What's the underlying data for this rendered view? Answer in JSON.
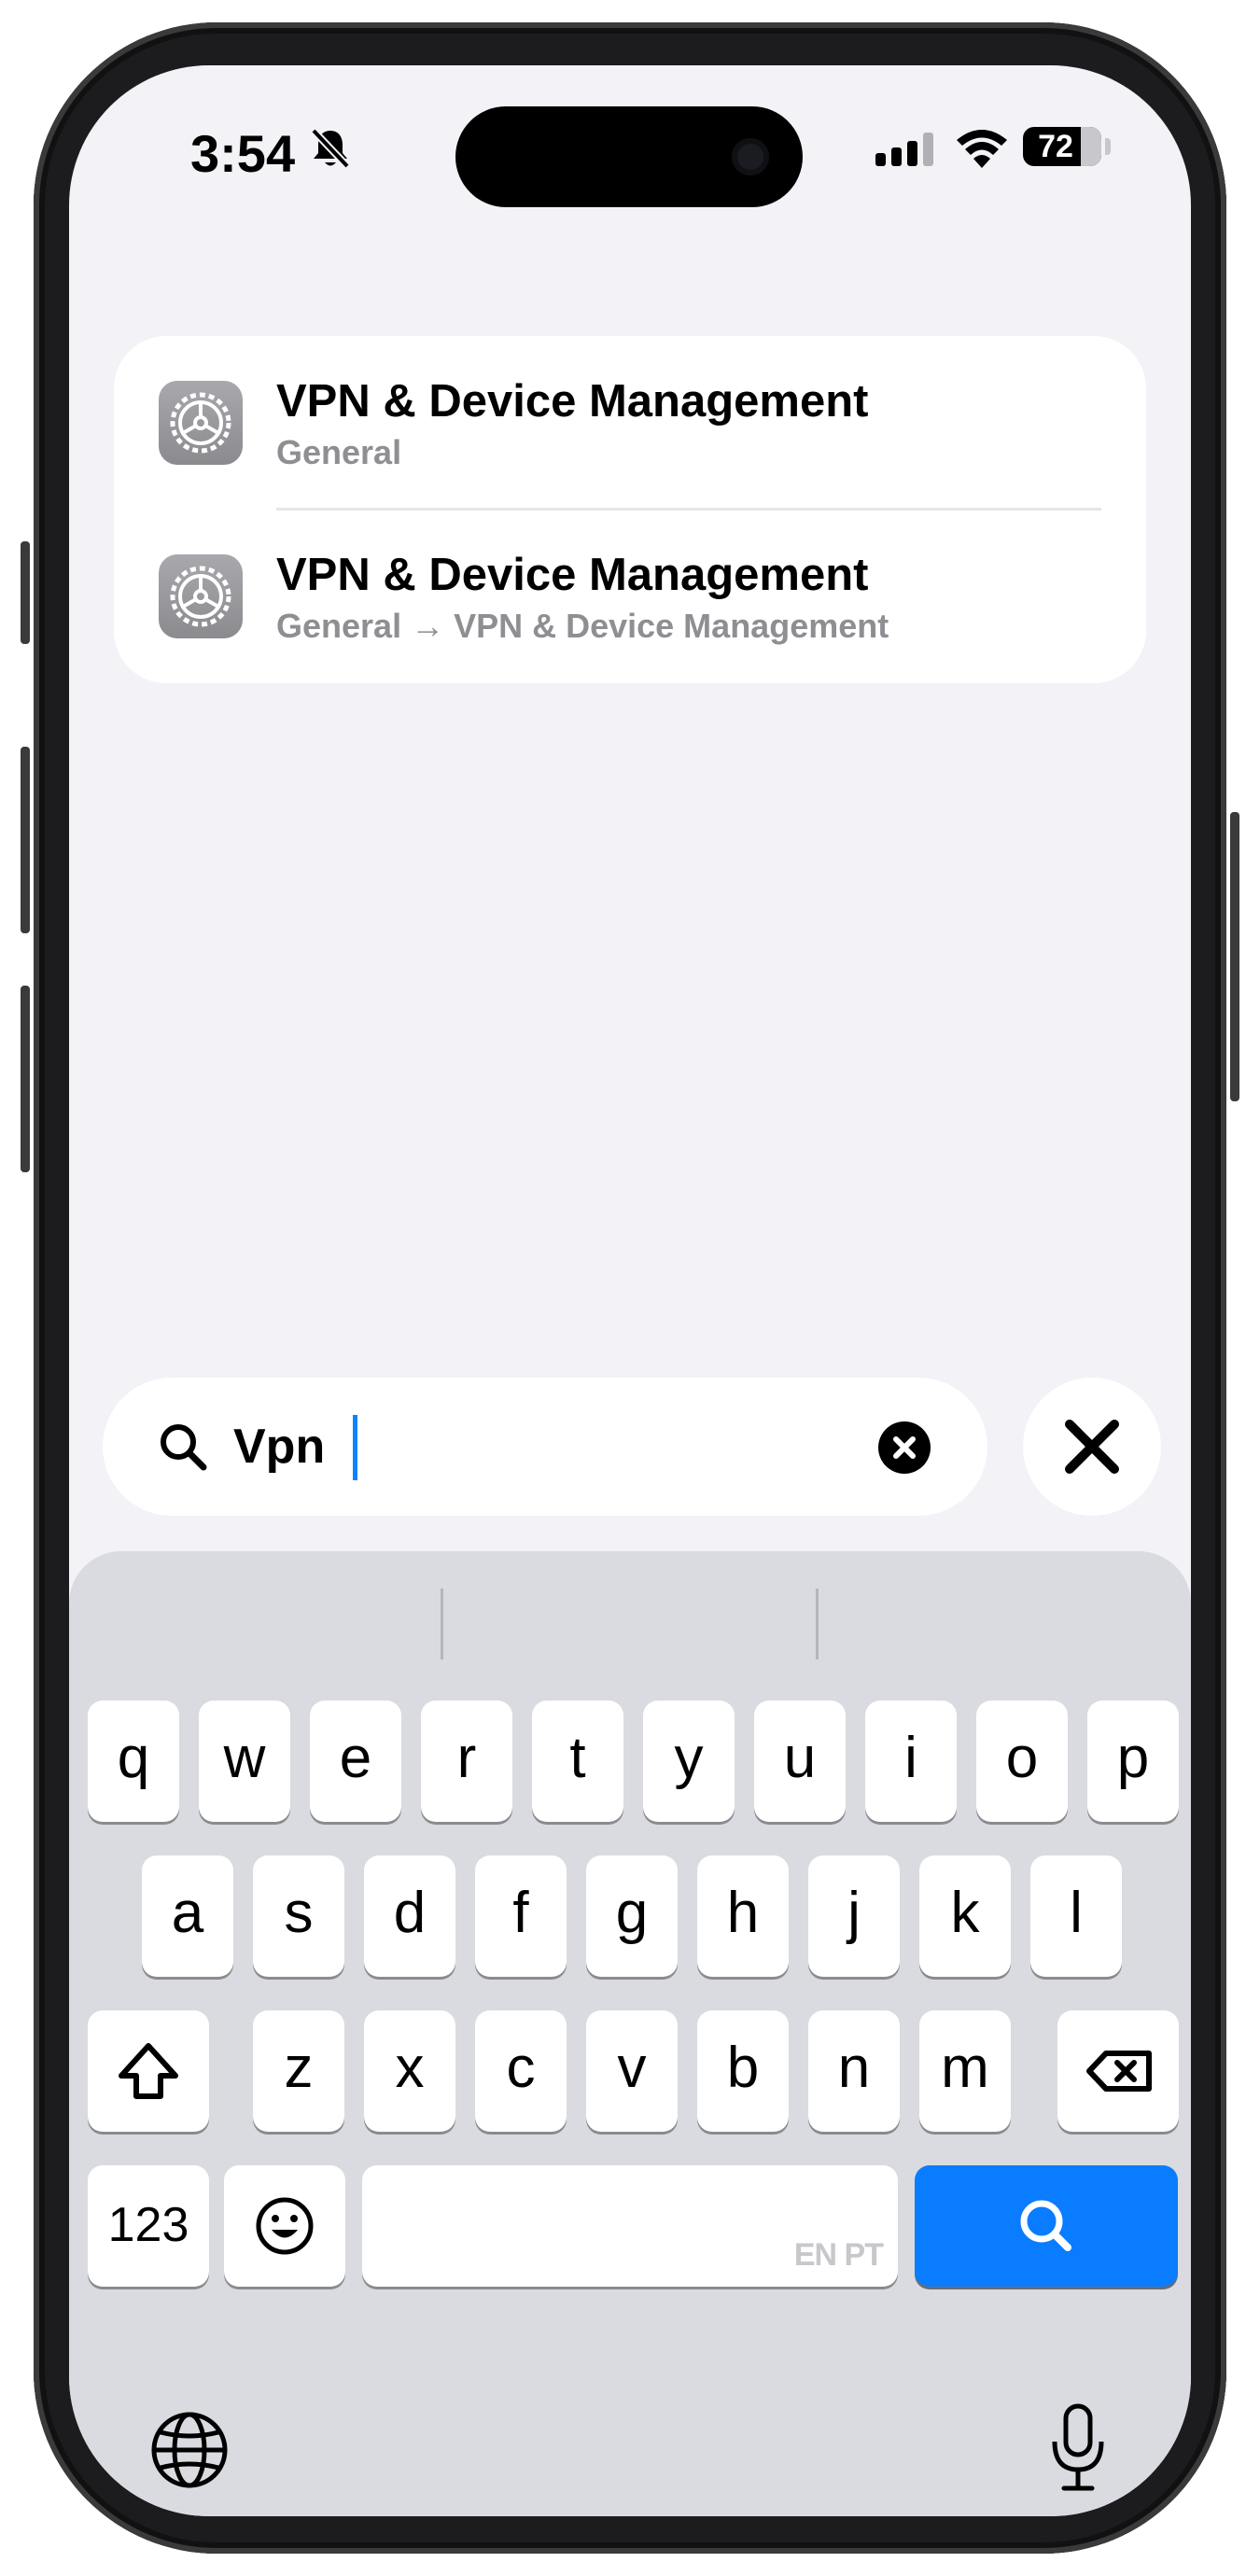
{
  "status_bar": {
    "time": "3:54",
    "battery": "72",
    "icons": [
      "bell-slash-icon",
      "cellular-signal-icon",
      "wifi-icon",
      "battery-icon"
    ]
  },
  "results": [
    {
      "title": "VPN & Device Management",
      "subtitle": "General",
      "icon": "settings-gear-icon"
    },
    {
      "title": "VPN & Device Management",
      "subtitle": "General → VPN & Device Management",
      "icon": "settings-gear-icon"
    }
  ],
  "search": {
    "value": "Vpn",
    "icons": [
      "search-icon",
      "clear-icon",
      "close-icon"
    ]
  },
  "keyboard": {
    "row1": [
      "q",
      "w",
      "e",
      "r",
      "t",
      "y",
      "u",
      "i",
      "o",
      "p"
    ],
    "row2": [
      "a",
      "s",
      "d",
      "f",
      "g",
      "h",
      "j",
      "k",
      "l"
    ],
    "row3": [
      "z",
      "x",
      "c",
      "v",
      "b",
      "n",
      "m"
    ],
    "numbers_key": "123",
    "space_languages": "EN PT",
    "icons": [
      "shift-icon",
      "backspace-icon",
      "emoji-icon",
      "search-icon",
      "globe-icon",
      "microphone-icon"
    ],
    "accent_color": "#0a7cff"
  }
}
